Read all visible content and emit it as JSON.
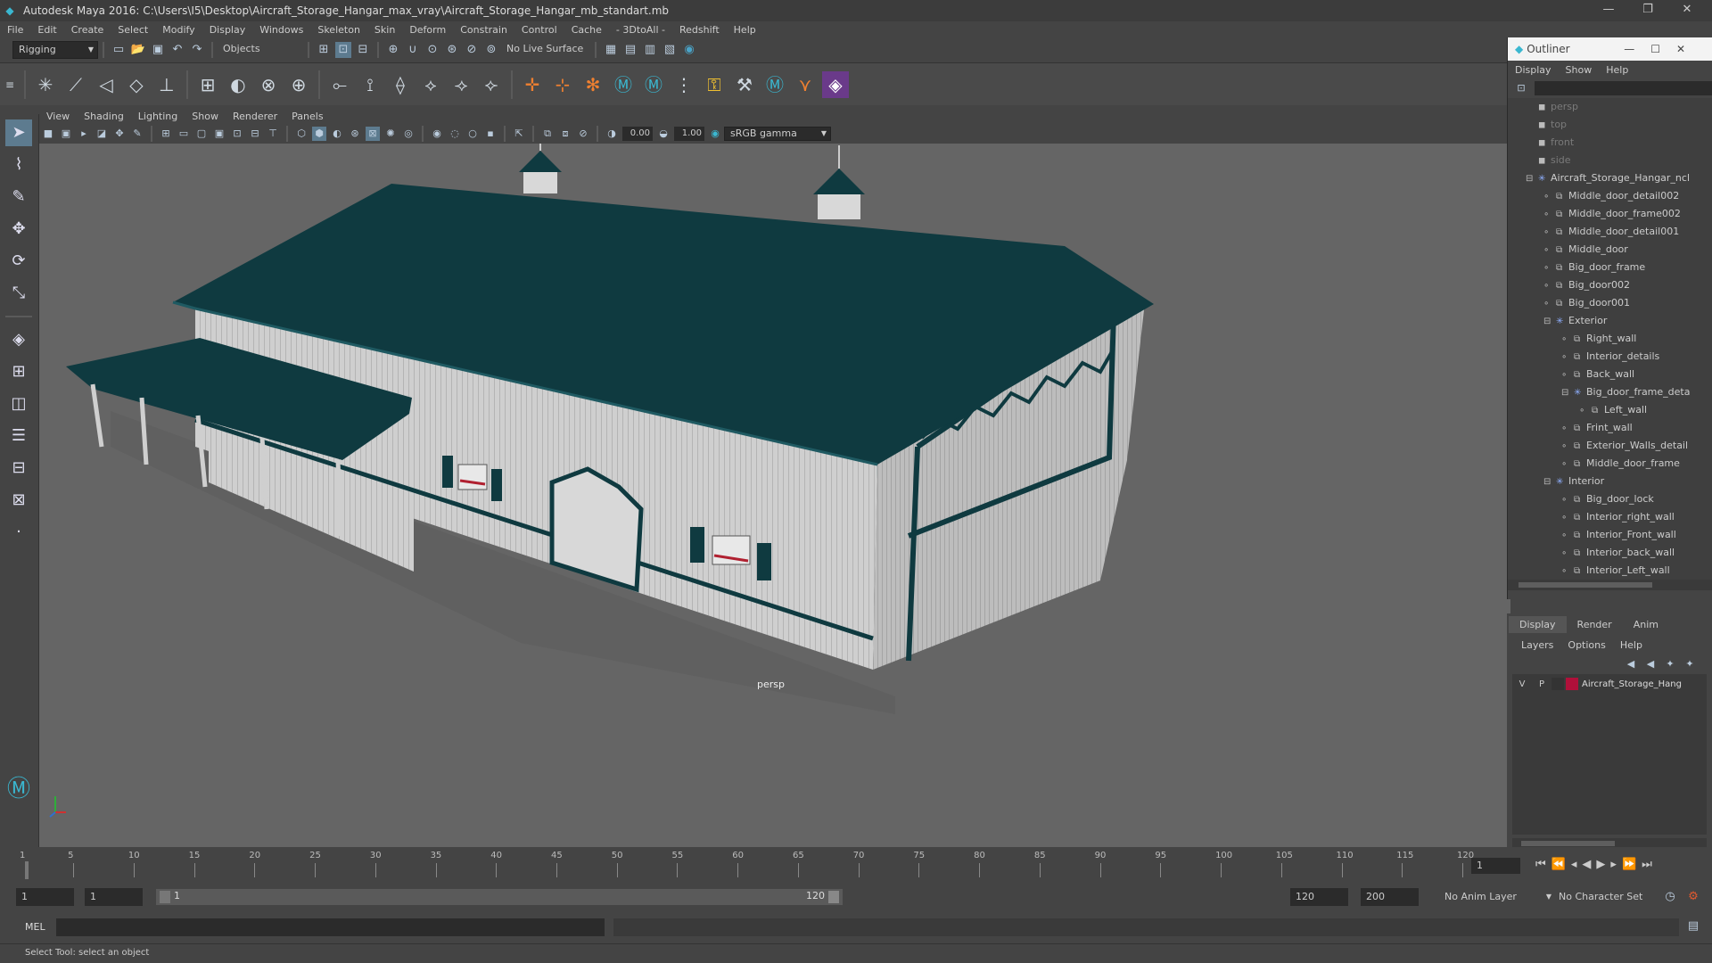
{
  "window": {
    "title": "Autodesk Maya 2016: C:\\Users\\I5\\Desktop\\Aircraft_Storage_Hangar_max_vray\\Aircraft_Storage_Hangar_mb_standart.mb"
  },
  "menu": [
    "File",
    "Edit",
    "Create",
    "Select",
    "Modify",
    "Display",
    "Windows",
    "Skeleton",
    "Skin",
    "Deform",
    "Constrain",
    "Control",
    "Cache",
    "- 3DtoAll -",
    "Redshift",
    "Help"
  ],
  "shelf": {
    "mode": "Rigging",
    "selection_mode": "Objects",
    "live_surface": "No Live Surface"
  },
  "viewport": {
    "menu": [
      "View",
      "Shading",
      "Lighting",
      "Show",
      "Renderer",
      "Panels"
    ],
    "exposure": "0.00",
    "gamma": "1.00",
    "color_space": "sRGB gamma",
    "camera_label": "persp"
  },
  "outliner": {
    "title": "Outliner",
    "menu": [
      "Display",
      "Show",
      "Help"
    ],
    "items": [
      {
        "label": "persp",
        "depth": 0,
        "dim": true
      },
      {
        "label": "top",
        "depth": 0,
        "dim": true
      },
      {
        "label": "front",
        "depth": 0,
        "dim": true
      },
      {
        "label": "side",
        "depth": 0,
        "dim": true
      },
      {
        "label": "Aircraft_Storage_Hangar_ncl",
        "depth": 0,
        "group": true
      },
      {
        "label": "Middle_door_detail002",
        "depth": 1
      },
      {
        "label": "Middle_door_frame002",
        "depth": 1
      },
      {
        "label": "Middle_door_detail001",
        "depth": 1
      },
      {
        "label": "Middle_door",
        "depth": 1
      },
      {
        "label": "Big_door_frame",
        "depth": 1
      },
      {
        "label": "Big_door002",
        "depth": 1
      },
      {
        "label": "Big_door001",
        "depth": 1
      },
      {
        "label": "Exterior",
        "depth": 1,
        "group": true
      },
      {
        "label": "Right_wall",
        "depth": 2
      },
      {
        "label": "Interior_details",
        "depth": 2
      },
      {
        "label": "Back_wall",
        "depth": 2
      },
      {
        "label": "Big_door_frame_deta",
        "depth": 2,
        "group": true
      },
      {
        "label": "Left_wall",
        "depth": 3
      },
      {
        "label": "Frint_wall",
        "depth": 2
      },
      {
        "label": "Exterior_Walls_detail",
        "depth": 2
      },
      {
        "label": "Middle_door_frame",
        "depth": 2
      },
      {
        "label": "Interior",
        "depth": 1,
        "group": true
      },
      {
        "label": "Big_door_lock",
        "depth": 2
      },
      {
        "label": "Interior_right_wall",
        "depth": 2
      },
      {
        "label": "Interior_Front_wall",
        "depth": 2
      },
      {
        "label": "Interior_back_wall",
        "depth": 2
      },
      {
        "label": "Interior_Left_wall",
        "depth": 2
      }
    ]
  },
  "layers": {
    "tabs": [
      "Display",
      "Render",
      "Anim"
    ],
    "menu": [
      "Layers",
      "Options",
      "Help"
    ],
    "layer": {
      "v": "V",
      "p": "P",
      "name": "Aircraft_Storage_Hang",
      "color": "#b0103a"
    }
  },
  "timeline": {
    "ticks": [
      "1",
      "5",
      "10",
      "15",
      "20",
      "25",
      "30",
      "35",
      "40",
      "45",
      "50",
      "55",
      "60",
      "65",
      "70",
      "75",
      "80",
      "85",
      "90",
      "95",
      "100",
      "105",
      "110",
      "115",
      "120"
    ],
    "current_frame": "1"
  },
  "range": {
    "start": "1",
    "playback_start": "1",
    "slider_start": "1",
    "slider_end": "120",
    "playback_end": "120",
    "end": "200",
    "anim_layer": "No Anim Layer",
    "character_set": "No Character Set"
  },
  "command": {
    "label": "MEL"
  },
  "help": {
    "text": "Select Tool: select an object"
  },
  "colors": {
    "roof": "#0f3a40",
    "accent": "#4aa3c7",
    "layer_swatch": "#b0103a"
  }
}
